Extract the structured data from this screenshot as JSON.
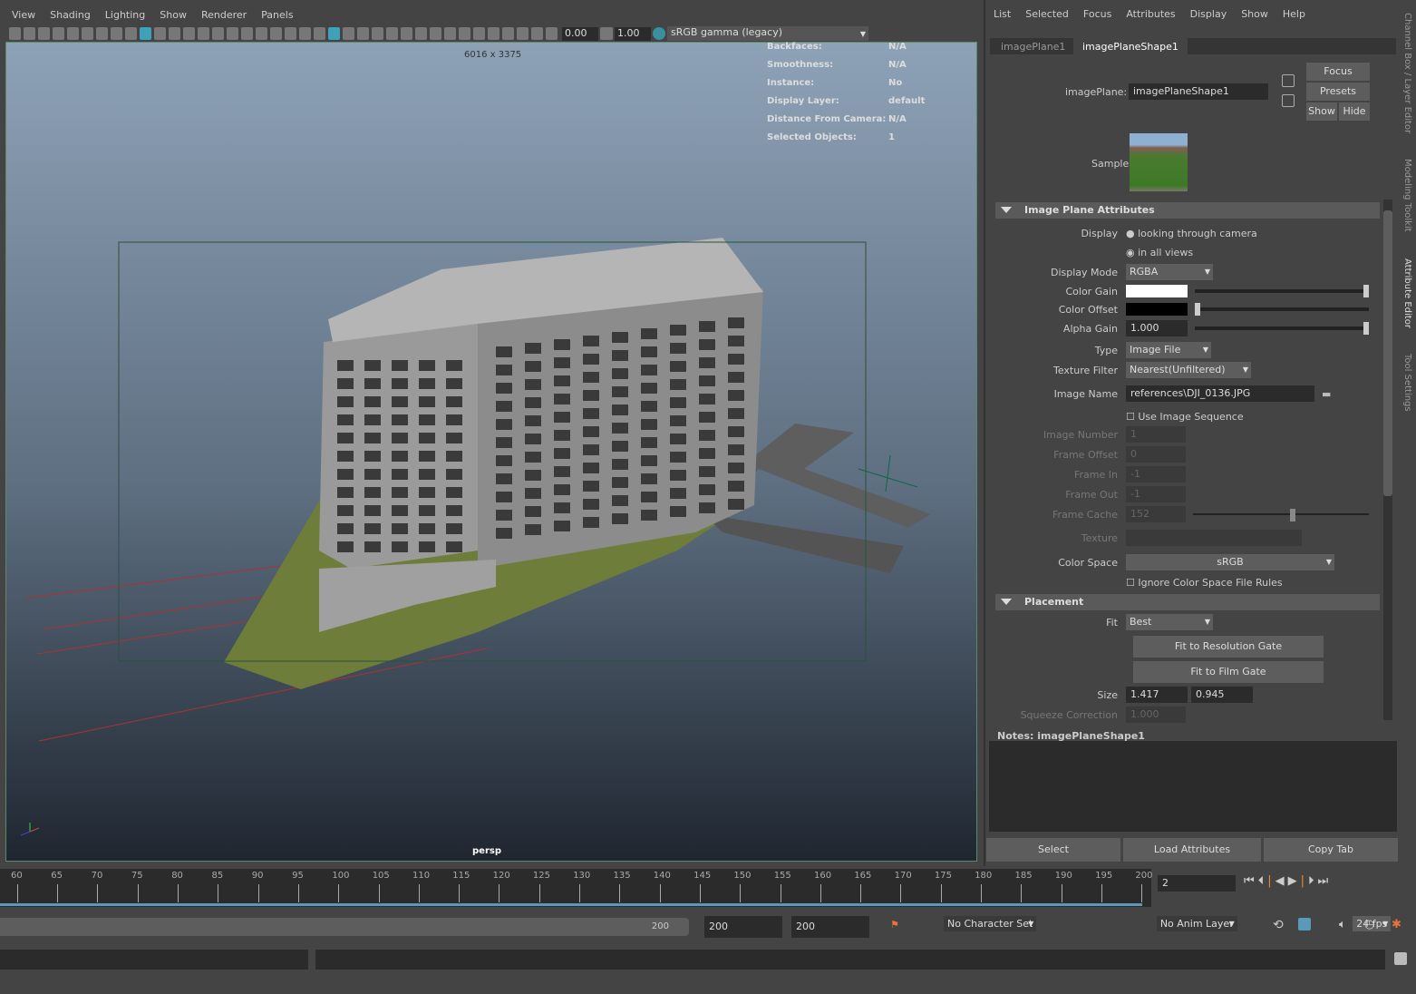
{
  "viewport": {
    "menu": [
      "View",
      "Shading",
      "Lighting",
      "Show",
      "Renderer",
      "Panels"
    ],
    "exposure": "0.00",
    "gamma": "1.00",
    "colorspace": "sRGB gamma (legacy)",
    "resolution": "6016 x 3375",
    "camera": "persp",
    "hud": [
      [
        "Backfaces:",
        "N/A"
      ],
      [
        "Smoothness:",
        "N/A"
      ],
      [
        "Instance:",
        "No"
      ],
      [
        "Display Layer:",
        "default"
      ],
      [
        "Distance From Camera:",
        "N/A"
      ],
      [
        "Selected Objects:",
        "1"
      ]
    ]
  },
  "attr": {
    "menu": [
      "List",
      "Selected",
      "Focus",
      "Attributes",
      "Display",
      "Show",
      "Help"
    ],
    "tabs": [
      "imagePlane1",
      "imagePlaneShape1"
    ],
    "node_label": "imagePlane:",
    "node_value": "imagePlaneShape1",
    "focus": "Focus",
    "presets": "Presets",
    "show": "Show",
    "hide": "Hide",
    "sample": "Sample",
    "sec1": "Image Plane Attributes",
    "display_label": "Display",
    "display_opts": [
      "looking through camera",
      "in all views"
    ],
    "display_mode": "RGBA",
    "color_gain": "#ffffff",
    "color_offset": "#000000",
    "alpha_gain": "1.000",
    "type": "Image File",
    "texture_filter": "Nearest(Unfiltered)",
    "image_name": "references\\DJI_0136.JPG",
    "use_seq": "Use Image Sequence",
    "image_number": "1",
    "frame_offset": "0",
    "frame_in": "-1",
    "frame_out": "-1",
    "frame_cache": "152",
    "color_space": "sRGB",
    "ignore_cs": "Ignore Color Space File Rules",
    "labels": {
      "display_mode": "Display Mode",
      "color_gain": "Color Gain",
      "color_offset": "Color Offset",
      "alpha_gain": "Alpha Gain",
      "type": "Type",
      "texture_filter": "Texture Filter",
      "image_name": "Image Name",
      "image_number": "Image Number",
      "frame_offset": "Frame Offset",
      "frame_in": "Frame In",
      "frame_out": "Frame Out",
      "frame_cache": "Frame Cache",
      "texture": "Texture",
      "color_space": "Color Space",
      "fit": "Fit",
      "size": "Size",
      "squeeze": "Squeeze Correction"
    },
    "sec2": "Placement",
    "fit": "Best",
    "fit_res": "Fit to Resolution Gate",
    "fit_film": "Fit to Film Gate",
    "size_w": "1.417",
    "size_h": "0.945",
    "squeeze": "1.000",
    "notes": "Notes:  imagePlaneShape1",
    "select": "Select",
    "load": "Load Attributes",
    "copy": "Copy Tab"
  },
  "side_tabs": [
    "Channel Box / Layer Editor",
    "Modeling Toolkit",
    "Attribute Editor",
    "Tool Settings"
  ],
  "timeline": {
    "ticks": [
      "60",
      "65",
      "70",
      "75",
      "80",
      "85",
      "90",
      "95",
      "100",
      "105",
      "110",
      "115",
      "120",
      "125",
      "130",
      "135",
      "140",
      "145",
      "150",
      "155",
      "160",
      "165",
      "170",
      "175",
      "180",
      "185",
      "190",
      "195",
      "200"
    ],
    "current": "2",
    "range_end": "200",
    "end1": "200",
    "end2": "200",
    "character_set": "No Character Set",
    "anim_layer": "No Anim Layer",
    "fps": "24 fps"
  }
}
